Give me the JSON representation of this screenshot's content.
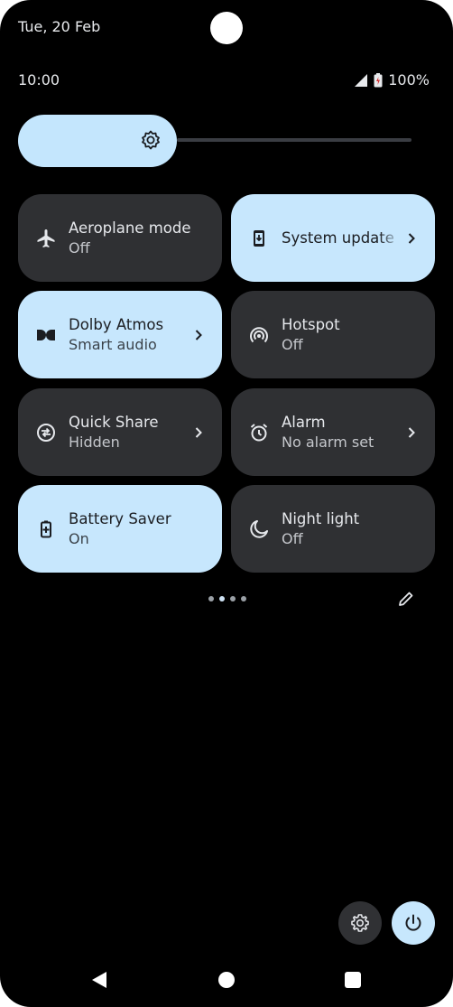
{
  "status_bar": {
    "date": "Tue, 20 Feb",
    "time": "10:00",
    "battery": "100%",
    "icons": [
      "signal-icon",
      "battery-icon"
    ]
  },
  "brightness": {
    "icon": "brightness-icon",
    "level": 0.35
  },
  "tiles": [
    {
      "title": "Aeroplane mode",
      "subtitle": "Off",
      "icon": "airplane-icon",
      "active": false,
      "chevron": false
    },
    {
      "title": "System update",
      "subtitle": "",
      "icon": "system-update-icon",
      "active": true,
      "chevron": true
    },
    {
      "title": "Dolby Atmos",
      "subtitle": "Smart audio",
      "icon": "dolby-icon",
      "active": true,
      "chevron": true
    },
    {
      "title": "Hotspot",
      "subtitle": "Off",
      "icon": "hotspot-icon",
      "active": false,
      "chevron": false
    },
    {
      "title": "Quick Share",
      "subtitle": "Hidden",
      "icon": "quick-share-icon",
      "active": false,
      "chevron": true
    },
    {
      "title": "Alarm",
      "subtitle": "No alarm set",
      "icon": "alarm-icon",
      "active": false,
      "chevron": true
    },
    {
      "title": "Battery Saver",
      "subtitle": "On",
      "icon": "battery-saver-icon",
      "active": true,
      "chevron": false
    },
    {
      "title": "Night light",
      "subtitle": "Off",
      "icon": "night-light-icon",
      "active": false,
      "chevron": false
    }
  ],
  "pager": {
    "pages": 4,
    "current": 2
  },
  "colors": {
    "tile_active": "#c7e7fd",
    "tile_inactive": "#2f3033",
    "background": "#000000"
  }
}
